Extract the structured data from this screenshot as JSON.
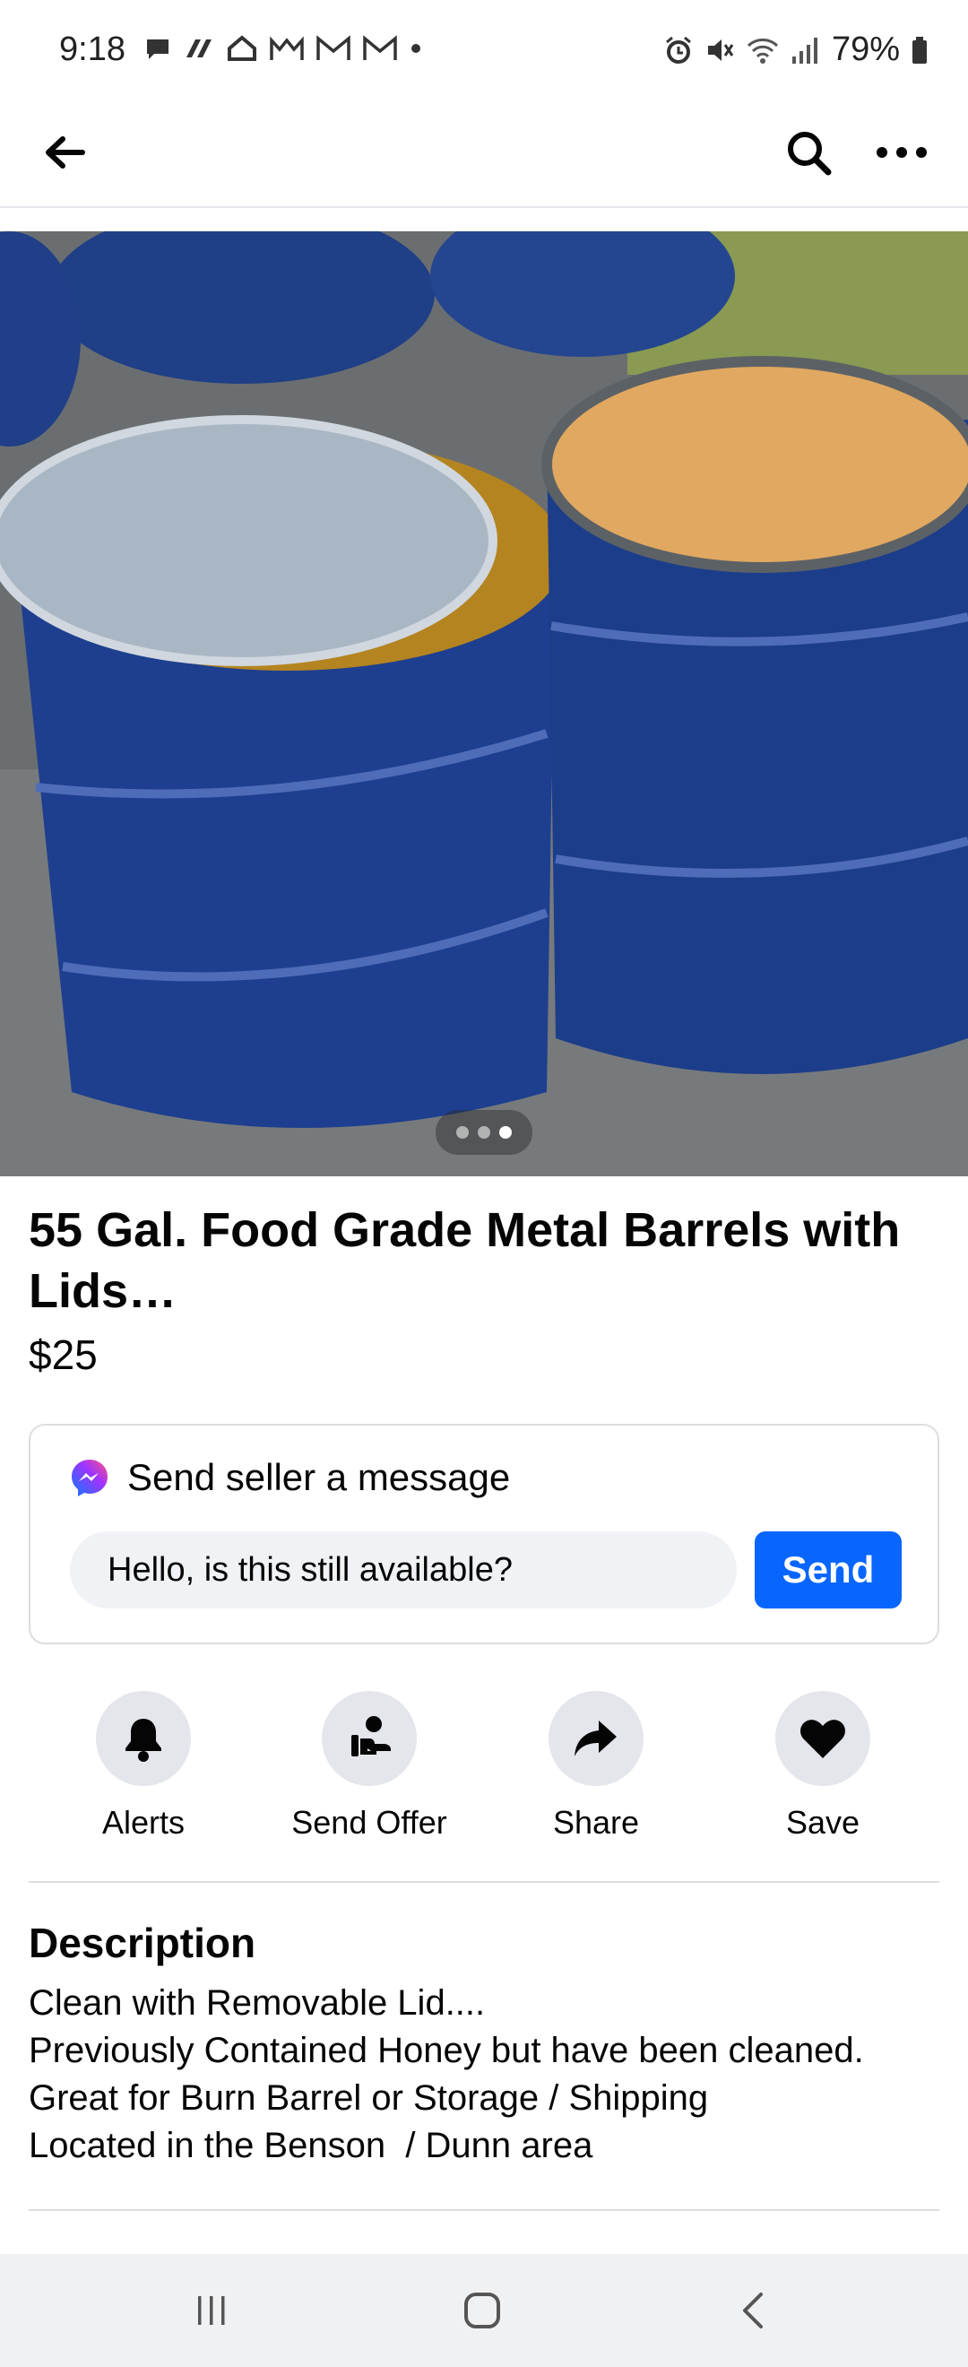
{
  "status_bar": {
    "time": "9:18",
    "battery": "79%"
  },
  "listing": {
    "title": "55 Gal. Food Grade Metal Barrels with Lids…",
    "price": "$25",
    "photo_count": 3,
    "active_photo": 3
  },
  "message": {
    "heading": "Send seller a message",
    "input_value": "Hello, is this still available?",
    "send_label": "Send"
  },
  "actions": [
    {
      "label": "Alerts",
      "icon": "bell-icon"
    },
    {
      "label": "Send Offer",
      "icon": "send-offer-icon"
    },
    {
      "label": "Share",
      "icon": "share-arrow-icon"
    },
    {
      "label": "Save",
      "icon": "heart-icon"
    }
  ],
  "description": {
    "heading": "Description",
    "lines": [
      "Clean with Removable Lid....",
      "Previously Contained Honey but have been cleaned.",
      "Great for Burn Barrel or Storage / Shipping",
      "Located in the Benson  / Dunn area"
    ]
  },
  "colors": {
    "accent": "#0866ff",
    "chip_bg": "#e4e6eb",
    "input_bg": "#f0f2f5"
  }
}
